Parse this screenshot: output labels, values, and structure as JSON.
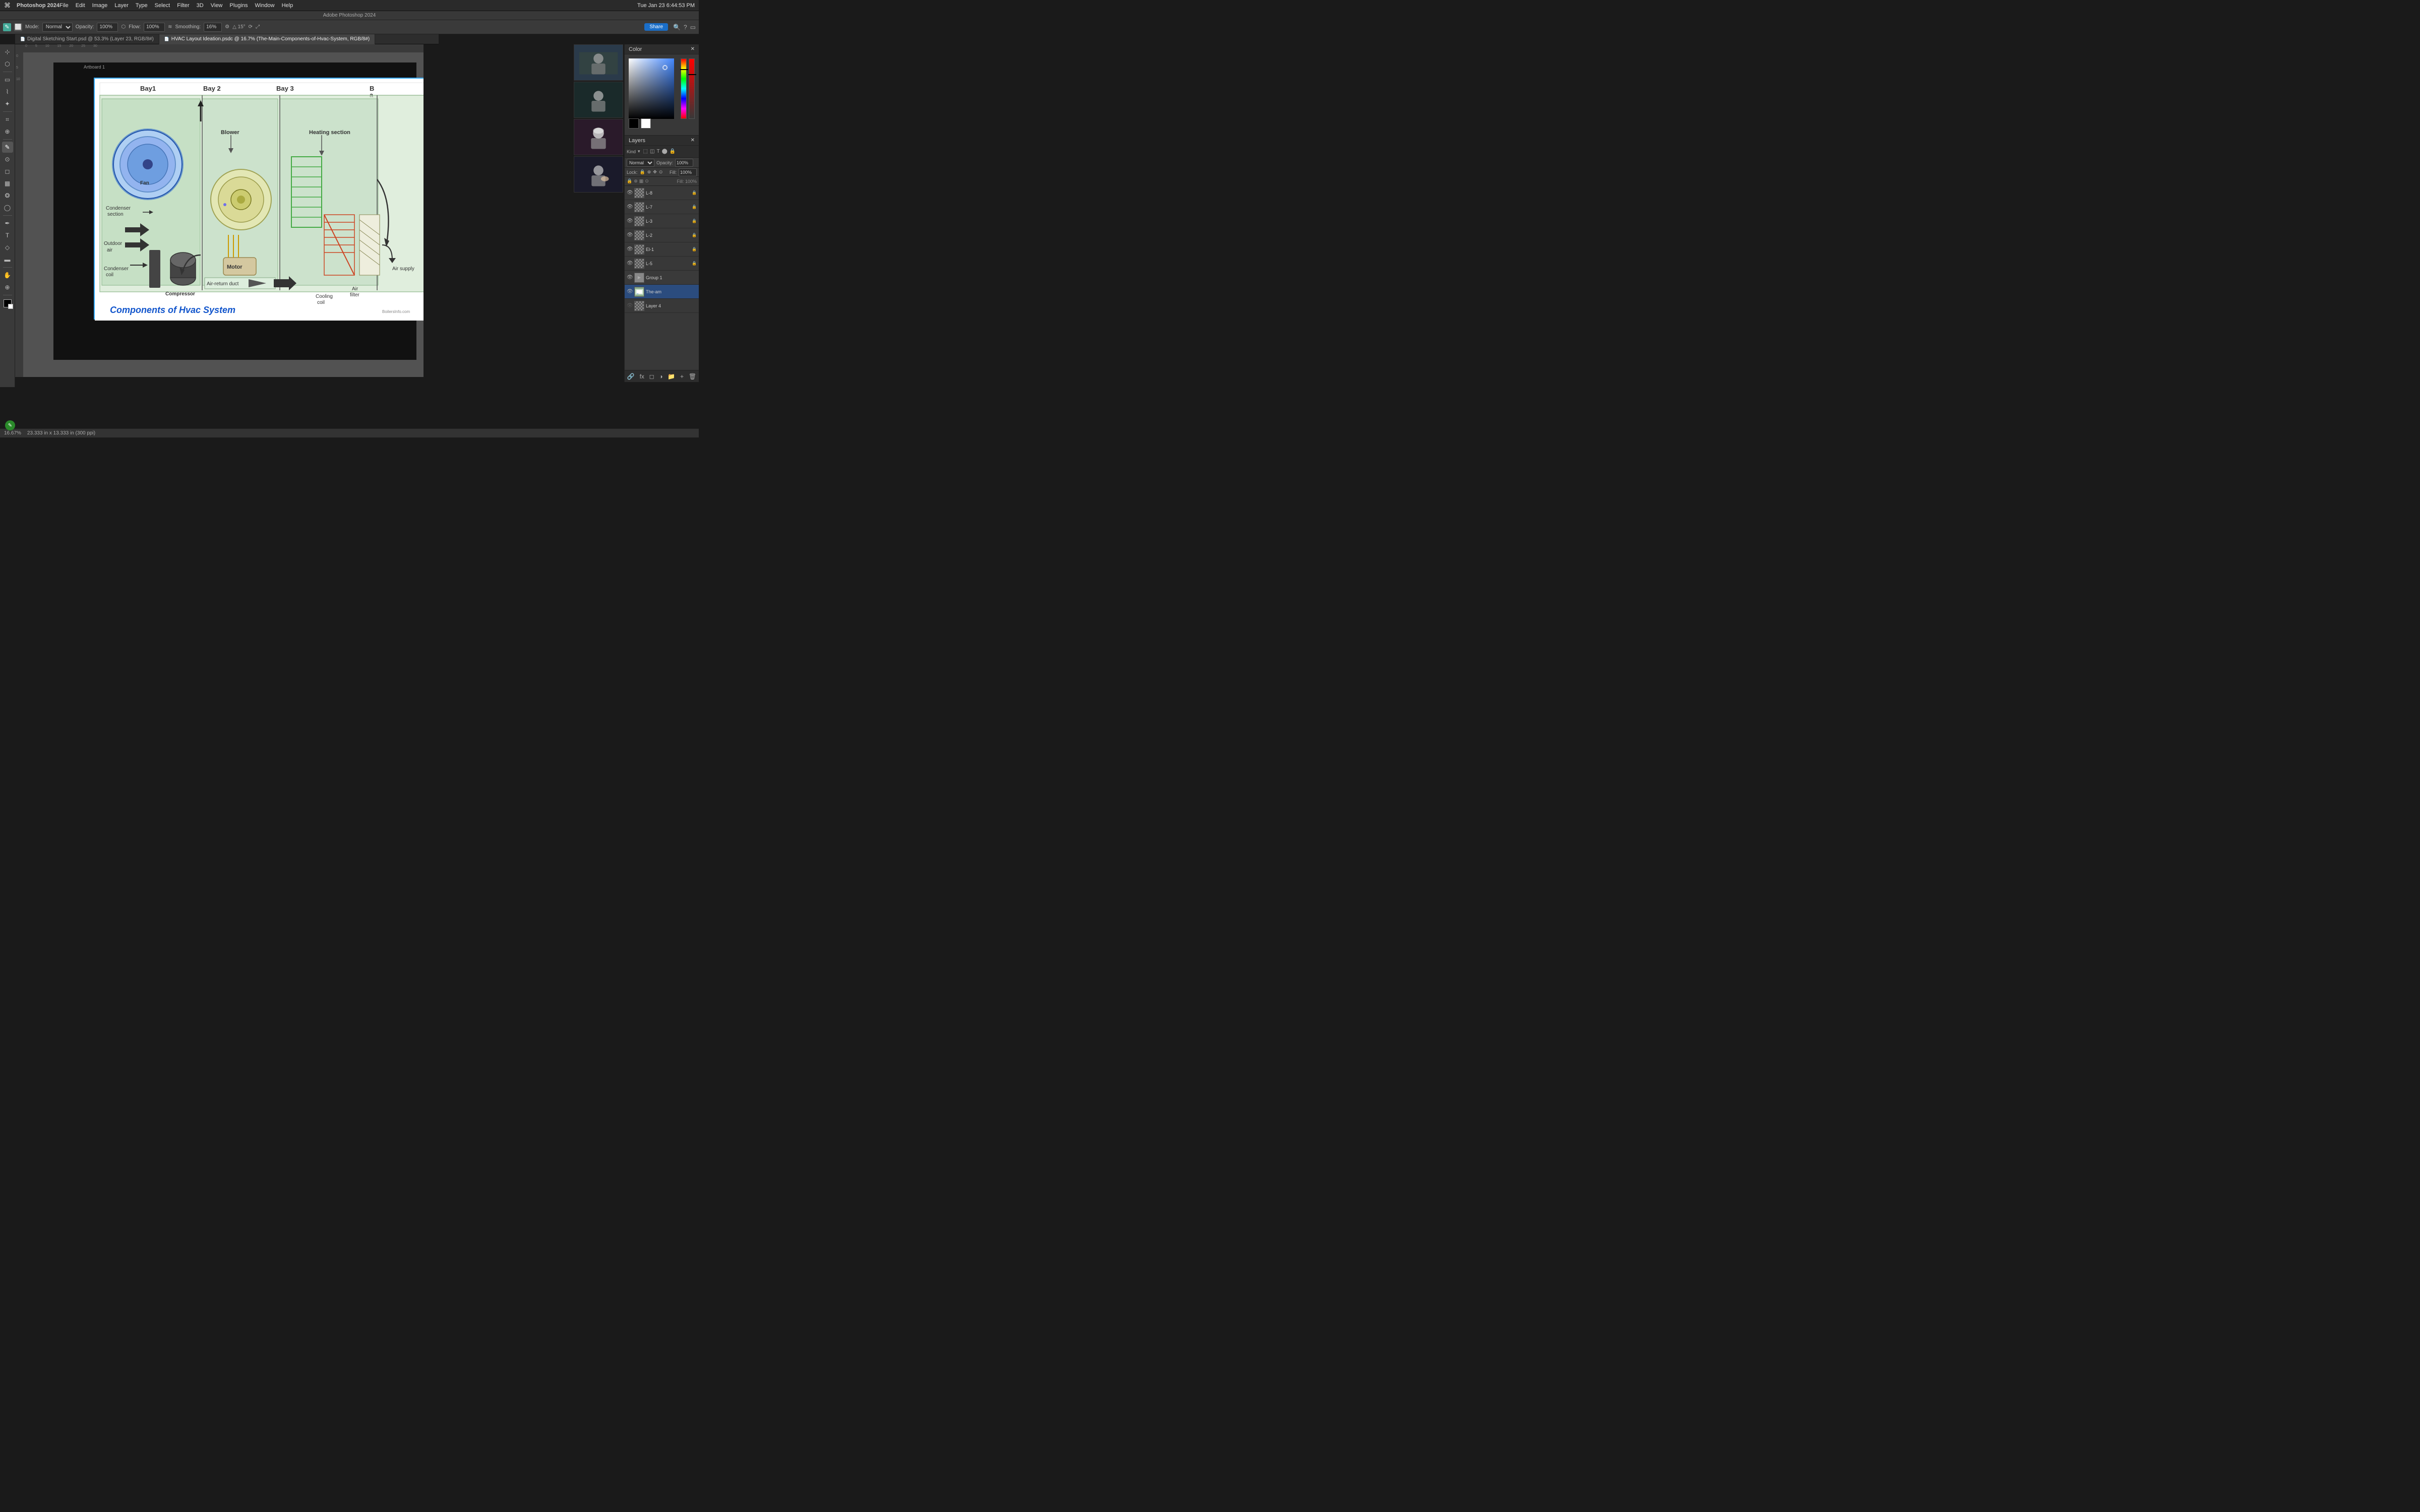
{
  "app": {
    "name": "Adobe Photoshop 2024",
    "title_bar": "Adobe Photoshop 2024"
  },
  "menu_bar": {
    "apple": "⌘",
    "app_name": "Photoshop 2024",
    "items": [
      "File",
      "Edit",
      "Image",
      "Layer",
      "Type",
      "Select",
      "Filter",
      "3D",
      "View",
      "Plugins",
      "Window",
      "Help"
    ],
    "right": {
      "date_time": "Tue Jan 23  6:44:53 PM"
    }
  },
  "options_bar": {
    "mode_label": "Mode:",
    "mode_value": "Normal",
    "opacity_label": "Opacity:",
    "opacity_value": "100%",
    "flow_label": "Flow:",
    "flow_value": "100%",
    "smoothing_label": "Smoothing:",
    "smoothing_value": "16%",
    "angle_value": "15°",
    "share_label": "Share"
  },
  "tabs": [
    {
      "label": "Digital Sketching Start.psd @ 53.3% (Layer 23, RGB/8#)",
      "active": false
    },
    {
      "label": "HVAC Layout Ideation.psdc @ 16.7% (The-Main-Components-of-Hvac-System, RGB/8#)",
      "active": true
    }
  ],
  "artboard": {
    "label": "Artboard 1"
  },
  "hvac_diagram": {
    "title": "Components of Hvac System",
    "source": "BoilersInfo.com",
    "bays": [
      "Bay1",
      "Bay2",
      "Bay3"
    ],
    "labels": [
      "Fan",
      "Blower",
      "Heating section",
      "Outdoor air",
      "Condenser section",
      "Motor",
      "Compressor",
      "Air-return duct",
      "Cooling coil",
      "Air filter",
      "Condenser coil",
      "Air supply"
    ]
  },
  "color_panel": {
    "title": "Color"
  },
  "layers_panel": {
    "title": "Layers",
    "search_placeholder": "Kind",
    "mode": "Normal",
    "opacity": "100%",
    "fill_label": "Fill:",
    "fill_value": "100%",
    "lock_label": "Lock:",
    "layers": [
      {
        "name": "L-8",
        "visible": true,
        "locked": true,
        "type": "checker"
      },
      {
        "name": "L-7",
        "visible": true,
        "locked": true,
        "type": "checker"
      },
      {
        "name": "L-3",
        "visible": true,
        "locked": true,
        "type": "checker"
      },
      {
        "name": "L-2",
        "visible": true,
        "locked": true,
        "type": "checker"
      },
      {
        "name": "El-1",
        "visible": true,
        "locked": true,
        "type": "checker"
      },
      {
        "name": "L-5",
        "visible": true,
        "locked": true,
        "type": "checker"
      },
      {
        "name": "Group 1",
        "visible": true,
        "locked": false,
        "type": "group"
      },
      {
        "name": "The-am",
        "visible": true,
        "locked": false,
        "type": "image",
        "is_hvac": true
      },
      {
        "name": "Layer 4",
        "visible": false,
        "locked": false,
        "type": "checker"
      }
    ]
  },
  "video_participants": [
    {
      "id": "p1",
      "initials": "👤"
    },
    {
      "id": "p2",
      "initials": "👤"
    },
    {
      "id": "p3",
      "initials": "👤"
    },
    {
      "id": "p4",
      "initials": "👤"
    }
  ],
  "status_bar": {
    "zoom": "16.67%",
    "dimensions": "23.333 in x 13.333 in (300 ppi)"
  }
}
